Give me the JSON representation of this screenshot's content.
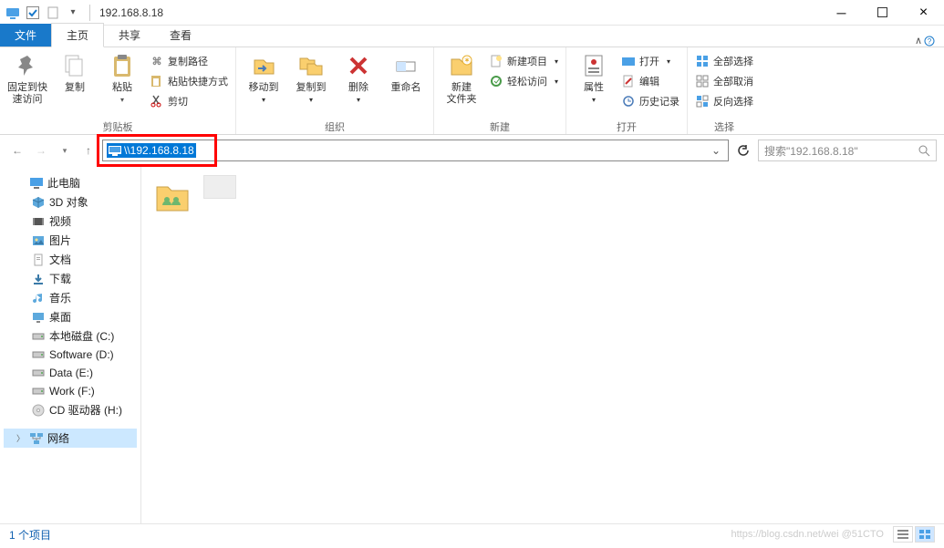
{
  "title": "192.168.8.18",
  "tabs": {
    "file": "文件",
    "home": "主页",
    "share": "共享",
    "view": "查看"
  },
  "ribbon": {
    "pin": "固定到快\n速访问",
    "copy": "复制",
    "paste": "粘贴",
    "copypath": "复制路径",
    "pasteshortcut": "粘贴快捷方式",
    "cut": "剪切",
    "clipboard": "剪贴板",
    "moveto": "移动到",
    "copyto": "复制到",
    "delete": "删除",
    "rename": "重命名",
    "organize": "组织",
    "newfolder": "新建\n文件夹",
    "newitem": "新建项目",
    "easyaccess": "轻松访问",
    "new": "新建",
    "properties": "属性",
    "open": "打开",
    "edit": "编辑",
    "history": "历史记录",
    "opengroup": "打开",
    "selectall": "全部选择",
    "selectnone": "全部取消",
    "invert": "反向选择",
    "select": "选择"
  },
  "address": "\\\\192.168.8.18",
  "search_placeholder": "搜索\"192.168.8.18\"",
  "tree": {
    "thispc": "此电脑",
    "objects3d": "3D 对象",
    "videos": "视频",
    "pictures": "图片",
    "documents": "文档",
    "downloads": "下载",
    "music": "音乐",
    "desktop": "桌面",
    "localc": "本地磁盘 (C:)",
    "softwared": "Software (D:)",
    "datae": "Data (E:)",
    "workf": "Work (F:)",
    "cdh": "CD 驱动器 (H:)",
    "network": "网络"
  },
  "status_text": "1 个项目",
  "watermark": "https://blog.csdn.net/wei  @51CTO"
}
